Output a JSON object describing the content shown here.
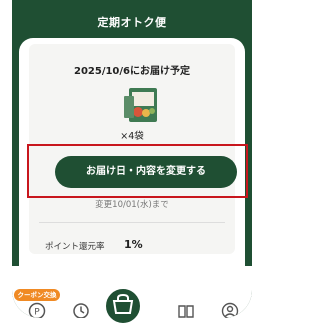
{
  "header": {
    "title": "定期オトク便"
  },
  "delivery": {
    "date_label": "2025/10/6にお届け予定",
    "quantity": "×4袋",
    "change_button_label": "お届け日・内容を変更する",
    "deadline": "変更10/01(水)まで"
  },
  "points": {
    "label": "ポイント還元率",
    "value": "1%"
  },
  "tabbar": {
    "coupon_badge": "クーポン交換",
    "icons": [
      "coupon-point-icon",
      "history-icon",
      "cart-icon",
      "book-icon",
      "account-icon"
    ]
  },
  "colors": {
    "brand": "#1f4f33",
    "accent": "#f08a24",
    "highlight": "#c8161d"
  }
}
